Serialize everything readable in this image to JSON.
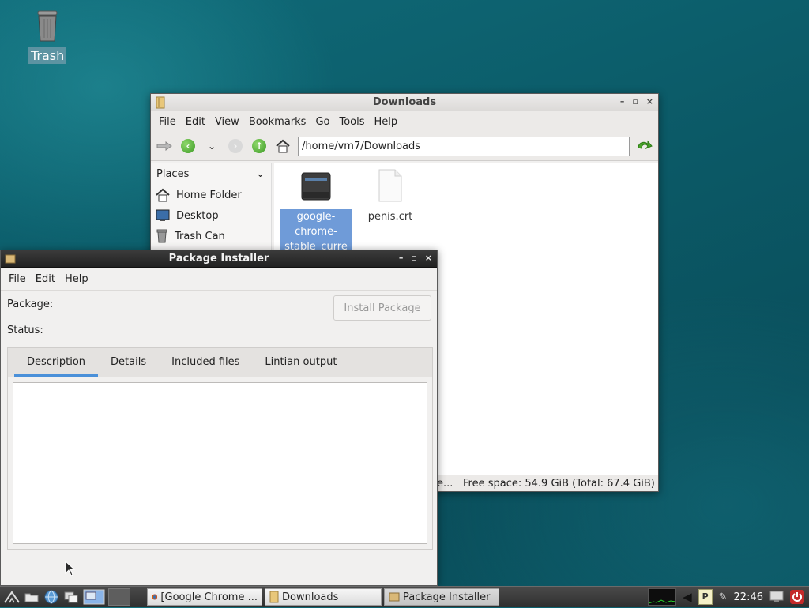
{
  "desktop": {
    "trash_label": "Trash"
  },
  "downloads": {
    "title": "Downloads",
    "menu": [
      "File",
      "Edit",
      "View",
      "Bookmarks",
      "Go",
      "Tools",
      "Help"
    ],
    "path": "/home/vm7/Downloads",
    "places_label": "Places",
    "places": [
      {
        "label": "Home Folder",
        "icon": "home-icon"
      },
      {
        "label": "Desktop",
        "icon": "desktop-icon"
      },
      {
        "label": "Trash Can",
        "icon": "trash-icon"
      }
    ],
    "files": [
      {
        "name": "google-\nchrome-\nstable_curre",
        "icon": "package-icon",
        "selected": true
      },
      {
        "name": "penis.crt",
        "icon": "document-icon",
        "selected": false
      }
    ],
    "status_left": "e...",
    "free_space": "Free space: 54.9 GiB (Total: 67.4 GiB)"
  },
  "installer": {
    "title": "Package Installer",
    "menu": [
      "File",
      "Edit",
      "Help"
    ],
    "package_label": "Package:",
    "status_label": "Status:",
    "install_button": "Install Package",
    "tabs": [
      "Description",
      "Details",
      "Included files",
      "Lintian output"
    ],
    "active_tab": "Description"
  },
  "taskbar": {
    "tasks": [
      {
        "label": "[Google Chrome ...",
        "icon": "firefox-icon"
      },
      {
        "label": "Downloads",
        "icon": "folder-icon"
      },
      {
        "label": "Package Installer",
        "icon": "package-icon"
      }
    ],
    "clock": "22:46"
  },
  "colors": {
    "selection": "#6f9bd8",
    "tab_indicator": "#4a90d9",
    "taskbar": "#2f2f2f"
  }
}
